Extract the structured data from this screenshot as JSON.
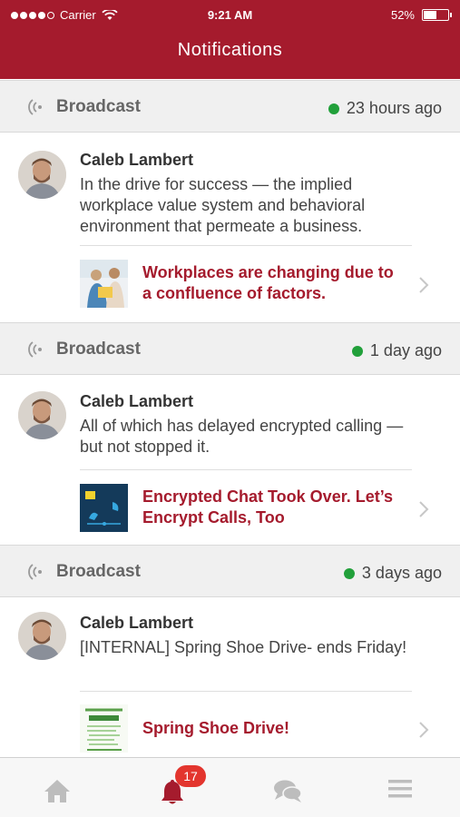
{
  "status_bar": {
    "carrier": "Carrier",
    "time": "9:21 AM",
    "battery": "52%",
    "battery_level": 0.52,
    "signal_bars_filled": 4,
    "signal_bars_total": 5
  },
  "header": {
    "title": "Notifications",
    "color": "#a51b2d"
  },
  "notifications": [
    {
      "section_label": "Broadcast",
      "time": "23 hours ago",
      "author": "Caleb Lambert",
      "message": "In the drive for success — the implied workplace value system and behavioral environment that permeate a business.",
      "link_title": "Workplaces are changing due to a confluence of factors."
    },
    {
      "section_label": "Broadcast",
      "time": "1 day ago",
      "author": "Caleb Lambert",
      "message": "All of which has delayed encrypted calling — but not stopped it.",
      "link_title": "Encrypted Chat Took Over. Let’s Encrypt Calls, Too"
    },
    {
      "section_label": "Broadcast",
      "time": "3 days ago",
      "author": "Caleb Lambert",
      "message": "[INTERNAL] Spring Shoe Drive- ends Friday!",
      "link_title": "Spring Shoe Drive!"
    }
  ],
  "tab_bar": {
    "tabs": [
      {
        "name": "home",
        "icon": "home-icon",
        "active": false
      },
      {
        "name": "notifications",
        "icon": "bell-icon",
        "active": true,
        "badge": "17"
      },
      {
        "name": "chat",
        "icon": "chat-bubbles-icon",
        "active": false
      },
      {
        "name": "menu",
        "icon": "hamburger-menu-icon",
        "active": false
      }
    ],
    "active_color": "#a51b2d",
    "inactive_color": "#bdbdbd",
    "badge_color": "#e3352e"
  },
  "colors": {
    "online_dot": "#21a03a",
    "link_text": "#a51b2d"
  }
}
